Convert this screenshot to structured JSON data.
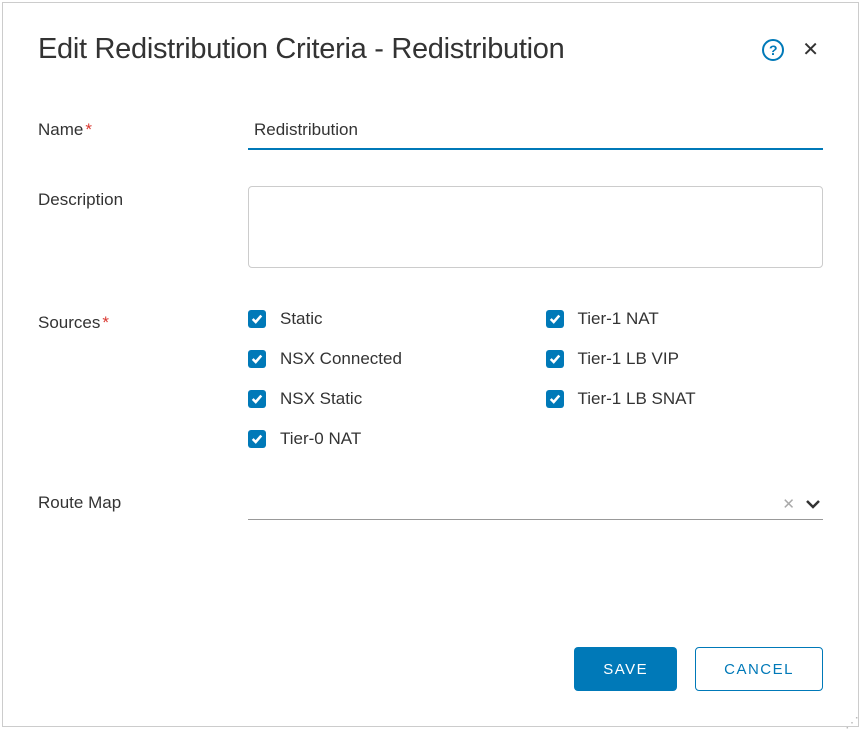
{
  "dialog": {
    "title": "Edit Redistribution Criteria - Redistribution"
  },
  "form": {
    "name": {
      "label": "Name",
      "value": "Redistribution"
    },
    "description": {
      "label": "Description",
      "value": ""
    },
    "sources": {
      "label": "Sources",
      "items": [
        {
          "label": "Static",
          "checked": true
        },
        {
          "label": "Tier-1 NAT",
          "checked": true
        },
        {
          "label": "NSX Connected",
          "checked": true
        },
        {
          "label": "Tier-1 LB VIP",
          "checked": true
        },
        {
          "label": "NSX Static",
          "checked": true
        },
        {
          "label": "Tier-1 LB SNAT",
          "checked": true
        },
        {
          "label": "Tier-0 NAT",
          "checked": true
        }
      ]
    },
    "routemap": {
      "label": "Route Map",
      "value": ""
    }
  },
  "buttons": {
    "save": "SAVE",
    "cancel": "CANCEL"
  },
  "icons": {
    "help": "?",
    "close": "✕",
    "clear": "✕"
  }
}
